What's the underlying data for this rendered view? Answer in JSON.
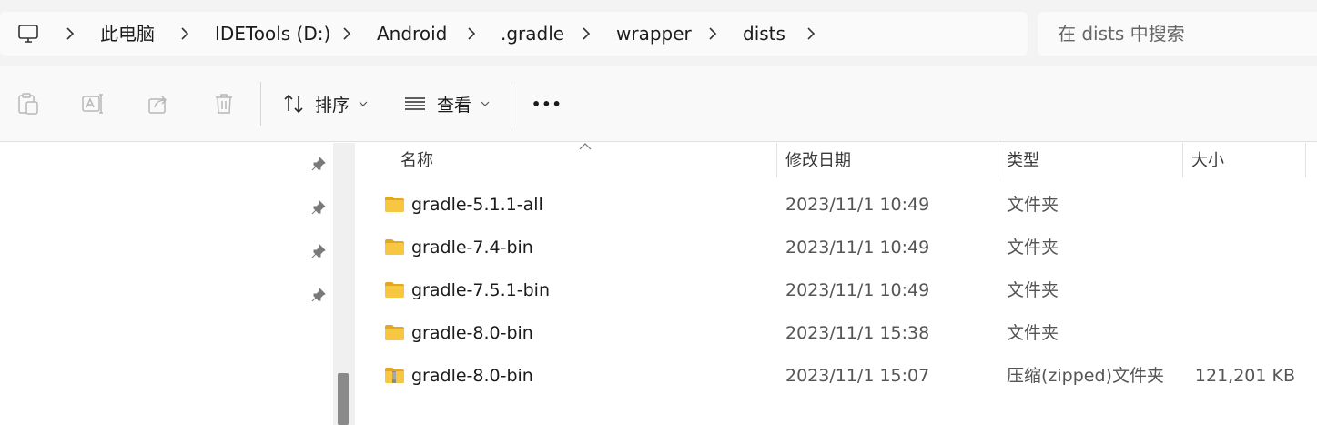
{
  "address_bar": {
    "breadcrumbs": [
      "此电脑",
      "IDETools (D:)",
      "Android",
      ".gradle",
      "wrapper",
      "dists"
    ]
  },
  "search": {
    "placeholder": "在 dists 中搜索"
  },
  "command_bar": {
    "sort_label": "排序",
    "view_label": "查看",
    "more_label": "•••"
  },
  "columns": {
    "name": "名称",
    "date": "修改日期",
    "type": "类型",
    "size": "大小"
  },
  "files": [
    {
      "name": "gradle-5.1.1-all",
      "date": "2023/11/1 10:49",
      "type": "文件夹",
      "size": "",
      "icon": "folder-icon"
    },
    {
      "name": "gradle-7.4-bin",
      "date": "2023/11/1 10:49",
      "type": "文件夹",
      "size": "",
      "icon": "folder-icon"
    },
    {
      "name": "gradle-7.5.1-bin",
      "date": "2023/11/1 10:49",
      "type": "文件夹",
      "size": "",
      "icon": "folder-icon"
    },
    {
      "name": "gradle-8.0-bin",
      "date": "2023/11/1 15:38",
      "type": "文件夹",
      "size": "",
      "icon": "folder-icon"
    },
    {
      "name": "gradle-8.0-bin",
      "date": "2023/11/1 15:07",
      "type": "压缩(zipped)文件夹",
      "size": "121,201 KB",
      "icon": "zip-folder-icon"
    }
  ],
  "colors": {
    "folder": "#f7c743",
    "folder_dark": "#e2a822",
    "accent": "#2f6fb6"
  }
}
